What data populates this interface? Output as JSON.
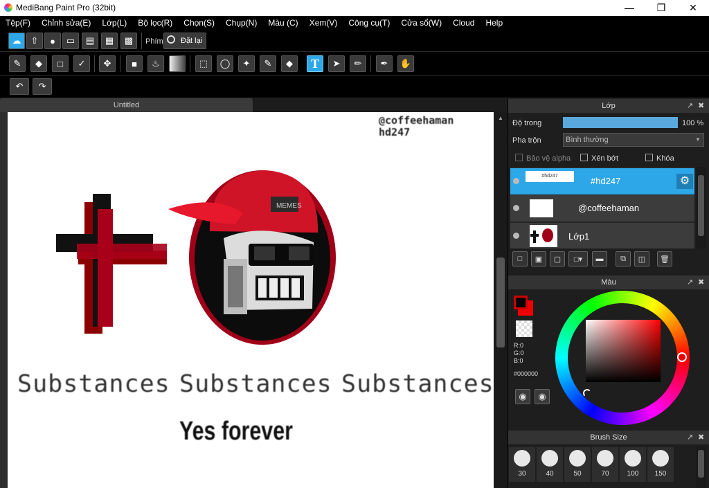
{
  "window": {
    "title": "MediBang Paint Pro (32bit)"
  },
  "menu": [
    "Tệp(F)",
    "Chỉnh sửa(E)",
    "Lớp(L)",
    "Bộ lọc(R)",
    "Chọn(S)",
    "Chụp(N)",
    "Màu (C)",
    "Xem(V)",
    "Công cụ(T)",
    "Cửa sổ(W)",
    "Cloud",
    "Help"
  ],
  "toolbar": {
    "shortcut_label": "Phím",
    "reset_label": "Đặt lại"
  },
  "document": {
    "tab_title": "Untitled"
  },
  "canvas": {
    "watermark_line1": "@coffeehaman",
    "watermark_line2": "hd247",
    "substances": [
      "Substances",
      "Substances",
      "Substances"
    ],
    "tagline": "Yes forever",
    "cap_label": "MEMES"
  },
  "layers_panel": {
    "title": "Lớp",
    "opacity_label": "Độ trong",
    "opacity_value": "100 %",
    "opacity_fraction": 1.0,
    "blend_label": "Pha trộn",
    "blend_value": "Bình thường",
    "protect_alpha": "Bảo vệ alpha",
    "clipping": "Xén bớt",
    "lock": "Khóa",
    "layers": [
      {
        "name": "#hd247",
        "thumb_text": "#hd247",
        "selected": true
      },
      {
        "name": "@coffeehaman",
        "thumb_text": "",
        "selected": false
      },
      {
        "name": "Lớp1",
        "thumb_text": "",
        "selected": false
      }
    ]
  },
  "color_panel": {
    "title": "Màu",
    "r": "R:0",
    "g": "G:0",
    "b": "B:0",
    "hex": "#000000",
    "foreground": "#cc0000",
    "accent": "#2ea7e8"
  },
  "brush_panel": {
    "title": "Brush Size",
    "sizes": [
      "30",
      "40",
      "50",
      "70",
      "100",
      "150"
    ]
  }
}
